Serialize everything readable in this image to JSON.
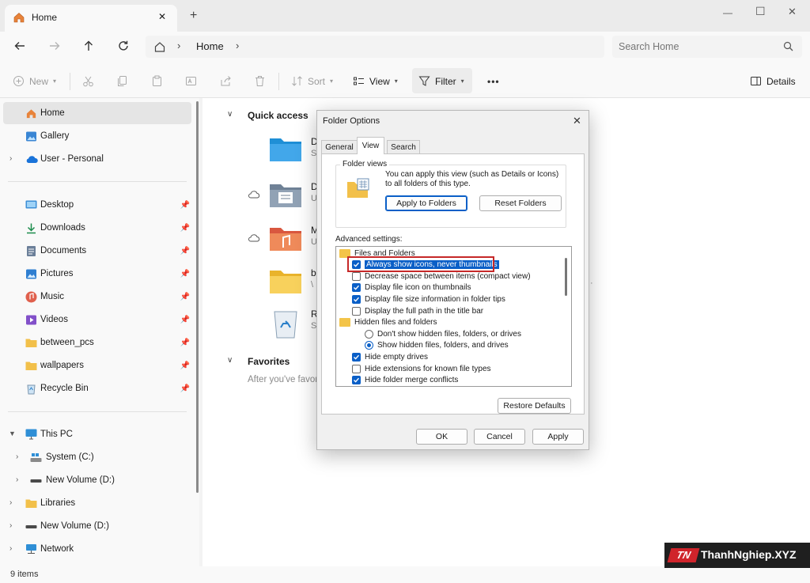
{
  "tab": {
    "title": "Home",
    "close": "✕",
    "new": "+"
  },
  "window_controls": {
    "minimize": "—",
    "maximize": "☐",
    "close": "✕"
  },
  "address": {
    "crumb": "Home",
    "sep": "›"
  },
  "search": {
    "placeholder": "Search Home"
  },
  "toolbar": {
    "new": "New",
    "sort": "Sort",
    "view": "View",
    "filter": "Filter",
    "more": "•••",
    "details": "Details"
  },
  "sidebar": {
    "top": [
      {
        "label": "Home",
        "icon": "home-icon"
      },
      {
        "label": "Gallery",
        "icon": "gallery-icon"
      },
      {
        "label": "User - Personal",
        "icon": "cloud-icon"
      }
    ],
    "pinned": [
      {
        "label": "Desktop",
        "icon": "desktop-icon"
      },
      {
        "label": "Downloads",
        "icon": "download-icon"
      },
      {
        "label": "Documents",
        "icon": "documents-icon"
      },
      {
        "label": "Pictures",
        "icon": "pictures-icon"
      },
      {
        "label": "Music",
        "icon": "music-icon"
      },
      {
        "label": "Videos",
        "icon": "videos-icon"
      },
      {
        "label": "between_pcs",
        "icon": "folder-icon"
      },
      {
        "label": "wallpapers",
        "icon": "folder-icon"
      },
      {
        "label": "Recycle Bin",
        "icon": "recycle-bin-icon"
      }
    ],
    "this_pc": "This PC",
    "drives": [
      {
        "label": "System (C:)",
        "icon": "drive-icon"
      },
      {
        "label": "New Volume (D:)",
        "icon": "drive-icon"
      }
    ],
    "bottom": [
      {
        "label": "Libraries",
        "icon": "folder-icon"
      },
      {
        "label": "New Volume (D:)",
        "icon": "drive-icon"
      },
      {
        "label": "Network",
        "icon": "network-icon"
      }
    ]
  },
  "main": {
    "quick_access": "Quick access",
    "items": [
      {
        "initial": "D",
        "sub": "S"
      },
      {
        "initial": "D",
        "sub": "U"
      },
      {
        "initial": "M",
        "sub": "U"
      },
      {
        "initial": "b",
        "sub": "\\"
      },
      {
        "initial": "R",
        "sub": "S"
      }
    ],
    "favorites": "Favorites",
    "favorites_hint": "After you've favor"
  },
  "status": {
    "count": "9 items"
  },
  "dialog": {
    "title": "Folder Options",
    "tabs": [
      "General",
      "View",
      "Search"
    ],
    "folder_views": {
      "legend": "Folder views",
      "text": "You can apply this view (such as Details or Icons) to all folders of this type.",
      "apply": "Apply to Folders",
      "reset": "Reset Folders"
    },
    "advanced_label": "Advanced settings:",
    "tree": [
      {
        "type": "folder",
        "label": "Files and Folders"
      },
      {
        "type": "check",
        "checked": true,
        "label": "Always show icons, never thumbnails",
        "highlight": true
      },
      {
        "type": "check",
        "checked": false,
        "label": "Decrease space between items (compact view)"
      },
      {
        "type": "check",
        "checked": true,
        "label": "Display file icon on thumbnails"
      },
      {
        "type": "check",
        "checked": true,
        "label": "Display file size information in folder tips"
      },
      {
        "type": "check",
        "checked": false,
        "label": "Display the full path in the title bar"
      },
      {
        "type": "folder",
        "label": "Hidden files and folders"
      },
      {
        "type": "radio",
        "checked": false,
        "label": "Don't show hidden files, folders, or drives"
      },
      {
        "type": "radio",
        "checked": true,
        "label": "Show hidden files, folders, and drives"
      },
      {
        "type": "check",
        "checked": true,
        "label": "Hide empty drives"
      },
      {
        "type": "check",
        "checked": false,
        "label": "Hide extensions for known file types"
      },
      {
        "type": "check",
        "checked": true,
        "label": "Hide folder merge conflicts"
      }
    ],
    "restore": "Restore Defaults",
    "ok": "OK",
    "cancel": "Cancel",
    "apply": "Apply"
  },
  "watermark": "ThanhNghiep.XYZ",
  "colors": {
    "accent": "#0a5fc7",
    "highlight_border": "#c62828"
  }
}
